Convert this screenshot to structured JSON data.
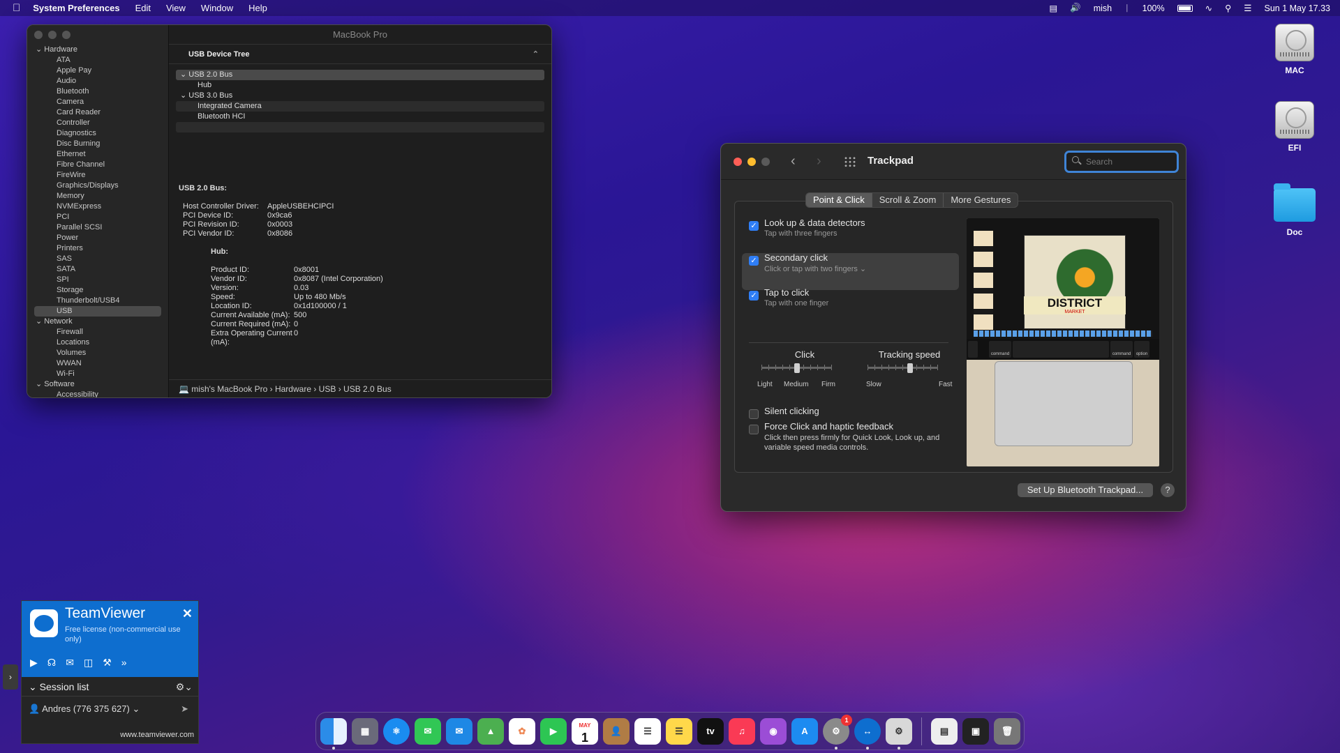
{
  "menubar": {
    "app": "System Preferences",
    "menus": [
      "Edit",
      "View",
      "Window",
      "Help"
    ],
    "user": "mish",
    "battery": "100%",
    "datetime": "Sun 1 May  17.33"
  },
  "desktop_icons": [
    {
      "label": "MAC",
      "icon": "hard-disk-icon"
    },
    {
      "label": "EFI",
      "icon": "hard-disk-icon"
    },
    {
      "label": "Doc",
      "icon": "folder-icon"
    }
  ],
  "sysinfo": {
    "title": "MacBook Pro",
    "sidebar": {
      "hardware_label": "Hardware",
      "hardware_items": [
        "ATA",
        "Apple Pay",
        "Audio",
        "Bluetooth",
        "Camera",
        "Card Reader",
        "Controller",
        "Diagnostics",
        "Disc Burning",
        "Ethernet",
        "Fibre Channel",
        "FireWire",
        "Graphics/Displays",
        "Memory",
        "NVMExpress",
        "PCI",
        "Parallel SCSI",
        "Power",
        "Printers",
        "SAS",
        "SATA",
        "SPI",
        "Storage",
        "Thunderbolt/USB4",
        "USB"
      ],
      "network_label": "Network",
      "network_items": [
        "Firewall",
        "Locations",
        "Volumes",
        "WWAN",
        "Wi-Fi"
      ],
      "software_label": "Software",
      "software_items": [
        "Accessibility"
      ]
    },
    "tree_header": "USB Device Tree",
    "tree": [
      "USB 2.0 Bus",
      "Hub",
      "USB 3.0 Bus",
      "Integrated Camera",
      "Bluetooth HCI"
    ],
    "detail_title": "USB 2.0 Bus:",
    "bus_props": [
      {
        "k": "Host Controller Driver:",
        "v": "AppleUSBEHCIPCI"
      },
      {
        "k": "PCI Device ID:",
        "v": "0x9ca6"
      },
      {
        "k": "PCI Revision ID:",
        "v": "0x0003"
      },
      {
        "k": "PCI Vendor ID:",
        "v": "0x8086"
      }
    ],
    "hub_title": "Hub:",
    "hub_props": [
      {
        "k": "Product ID:",
        "v": "0x8001"
      },
      {
        "k": "Vendor ID:",
        "v": "0x8087  (Intel Corporation)"
      },
      {
        "k": "Version:",
        "v": "0.03"
      },
      {
        "k": "Speed:",
        "v": "Up to 480 Mb/s"
      },
      {
        "k": "Location ID:",
        "v": "0x1d100000 / 1"
      },
      {
        "k": "Current Available (mA):",
        "v": "500"
      },
      {
        "k": "Current Required (mA):",
        "v": "0"
      },
      {
        "k": "Extra Operating Current (mA):",
        "v": "0"
      }
    ],
    "path": [
      "mish's MacBook Pro",
      "Hardware",
      "USB",
      "USB 2.0 Bus"
    ]
  },
  "trackpad": {
    "title": "Trackpad",
    "search_placeholder": "Search",
    "tabs": [
      "Point & Click",
      "Scroll & Zoom",
      "More Gestures"
    ],
    "options": [
      {
        "label": "Look up & data detectors",
        "sub": "Tap with three fingers",
        "checked": true
      },
      {
        "label": "Secondary click",
        "sub": "Click or tap with two fingers ⌄",
        "checked": true
      },
      {
        "label": "Tap to click",
        "sub": "Tap with one finger",
        "checked": true
      }
    ],
    "click_label": "Click",
    "click_ticks": [
      "Light",
      "Medium",
      "Firm"
    ],
    "click_level": 0.5,
    "speed_label": "Tracking speed",
    "speed_ticks": [
      "Slow",
      "Fast"
    ],
    "speed_level": 0.6,
    "silent_label": "Silent clicking",
    "force_label": "Force Click and haptic feedback",
    "force_desc": "Click then press firmly for Quick Look, Look up, and variable speed media controls.",
    "preview_title": "DISTRICT",
    "preview_sub": "MARKET",
    "preview_keys": [
      "command",
      "command",
      "option"
    ],
    "setup_button": "Set Up Bluetooth Trackpad...",
    "help": "?"
  },
  "teamviewer": {
    "name": "TeamViewer",
    "license": "Free license (non-commercial use only)",
    "session_label": "Session list",
    "user": "Andres (776 375 627)",
    "url": "www.teamviewer.com"
  },
  "dock": {
    "calendar_month": "MAY",
    "calendar_day": "1",
    "tv_label": "tv",
    "settings_badge": "1"
  }
}
